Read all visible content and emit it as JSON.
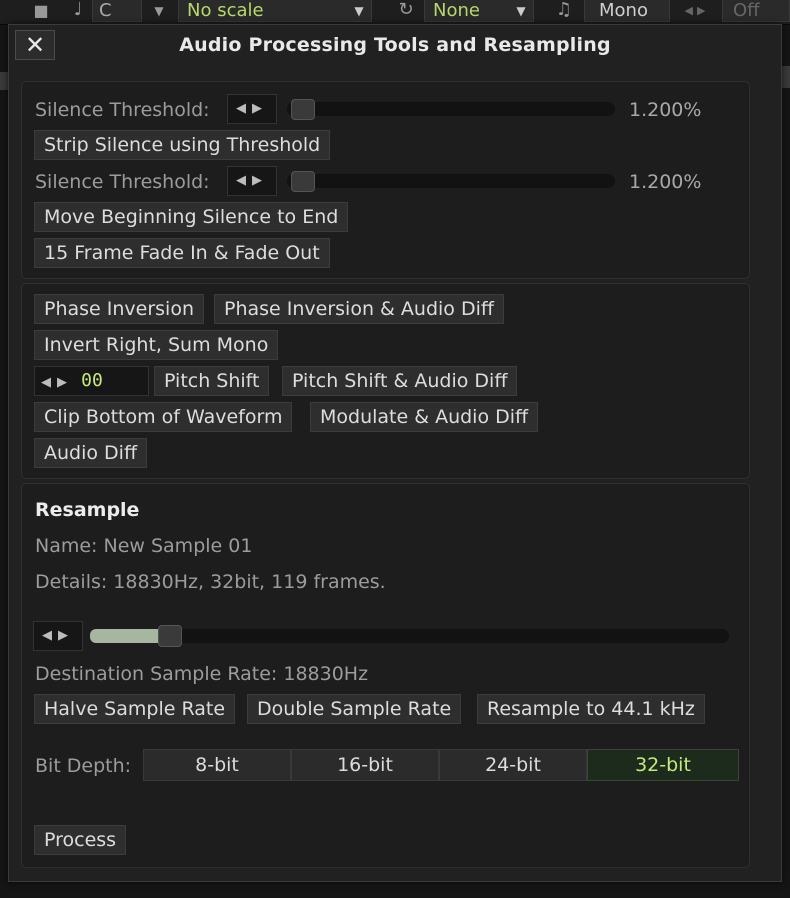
{
  "toolbar": {
    "key_value": "C",
    "scale_value": "No scale",
    "chord_value": "None",
    "mode_value": "Mono",
    "toggle_value": "Off"
  },
  "dialog": {
    "title": "Audio Processing Tools and Resampling",
    "close_label": "✕"
  },
  "silence": {
    "threshold_label": "Silence Threshold:",
    "threshold_value": "1.200%",
    "threshold_fraction": 0.012,
    "strip_button": "Strip Silence using Threshold",
    "threshold2_label": "Silence Threshold:",
    "threshold2_value": "1.200%",
    "threshold2_fraction": 0.012,
    "move_button": "Move Beginning Silence to End",
    "fade_button": "15 Frame Fade In & Fade Out"
  },
  "effects": {
    "phase_inversion": "Phase Inversion",
    "phase_inversion_diff": "Phase Inversion & Audio Diff",
    "invert_right": "Invert Right, Sum Mono",
    "pitch_value": "00",
    "pitch_shift": "Pitch Shift",
    "pitch_shift_diff": "Pitch Shift & Audio Diff",
    "clip_bottom": "Clip Bottom of Waveform",
    "modulate_diff": "Modulate & Audio Diff",
    "audio_diff": "Audio Diff"
  },
  "resample": {
    "heading": "Resample",
    "name_line": "Name: New Sample 01",
    "details_line": "Details: 18830Hz, 32bit, 119 frames.",
    "rate_fraction": 0.11,
    "destination_line": "Destination Sample Rate: 18830Hz",
    "halve_button": "Halve Sample Rate",
    "double_button": "Double Sample Rate",
    "resample_44_button": "Resample to 44.1 kHz",
    "bit_depth_label": "Bit Depth:",
    "bit_depths": [
      "8-bit",
      "16-bit",
      "24-bit",
      "32-bit"
    ],
    "selected_bit_depth": "32-bit",
    "process_button": "Process"
  },
  "icons": {
    "close": "close-icon",
    "arrows": "left-right-arrows-icon",
    "save": "save-icon",
    "note": "note-icon",
    "dropdown": "dropdown-arrow-icon",
    "loop": "loop-icon"
  },
  "colors": {
    "accent_green": "#c4e97d",
    "active_segment_bg": "#1c2b1c",
    "slider_fill": "#a7b79f"
  }
}
